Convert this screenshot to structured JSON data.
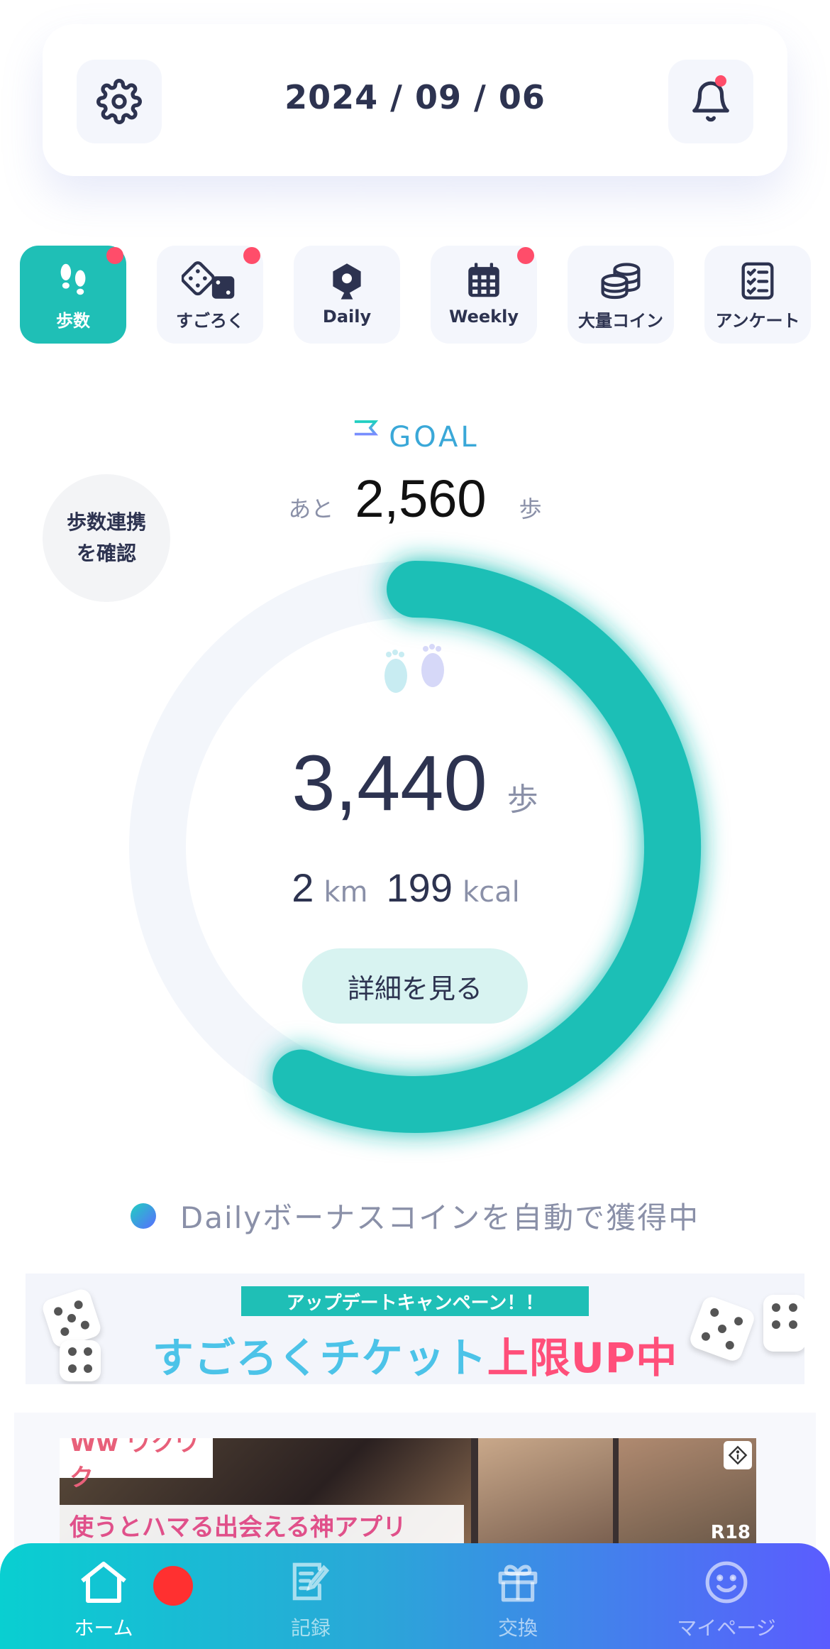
{
  "header": {
    "date": "2024 / 09 / 06"
  },
  "tabs": [
    {
      "label": "歩数",
      "active": true,
      "badge": true
    },
    {
      "label": "すごろく",
      "active": false,
      "badge": true
    },
    {
      "label": "Daily",
      "active": false,
      "badge": false
    },
    {
      "label": "Weekly",
      "active": false,
      "badge": true
    },
    {
      "label": "大量コイン",
      "active": false,
      "badge": false
    },
    {
      "label": "アンケート",
      "active": false,
      "badge": false
    }
  ],
  "goal": {
    "label": "GOAL",
    "prefix": "あと",
    "remaining": "2,560",
    "unit": "歩"
  },
  "sync_button": {
    "line1": "歩数連携",
    "line2": "を確認"
  },
  "steps": {
    "value": "3,440",
    "unit": "歩",
    "goal_progress": 0.573
  },
  "stats": {
    "distance": "2",
    "distance_unit": "km",
    "calories": "199",
    "calories_unit": "kcal"
  },
  "detail_button": "詳細を見る",
  "bonus_text": "Dailyボーナスコインを自動で獲得中",
  "banner": {
    "tag": "アップデートキャンペーン！！",
    "main_a": "すごろくチケット",
    "main_b": "上限UP中"
  },
  "ad": {
    "brand": "Ww ワクワク",
    "copy": "使うとハマる出会える神アプリ",
    "rating": "R18"
  },
  "nav": [
    {
      "label": "ホーム",
      "active": true
    },
    {
      "label": "記録",
      "active": false
    },
    {
      "label": "交換",
      "active": false
    },
    {
      "label": "マイページ",
      "active": false
    }
  ],
  "colors": {
    "accent": "#1fbfb6",
    "badge": "#ff4d6a",
    "text": "#2d3350",
    "muted": "#8a90a8"
  }
}
